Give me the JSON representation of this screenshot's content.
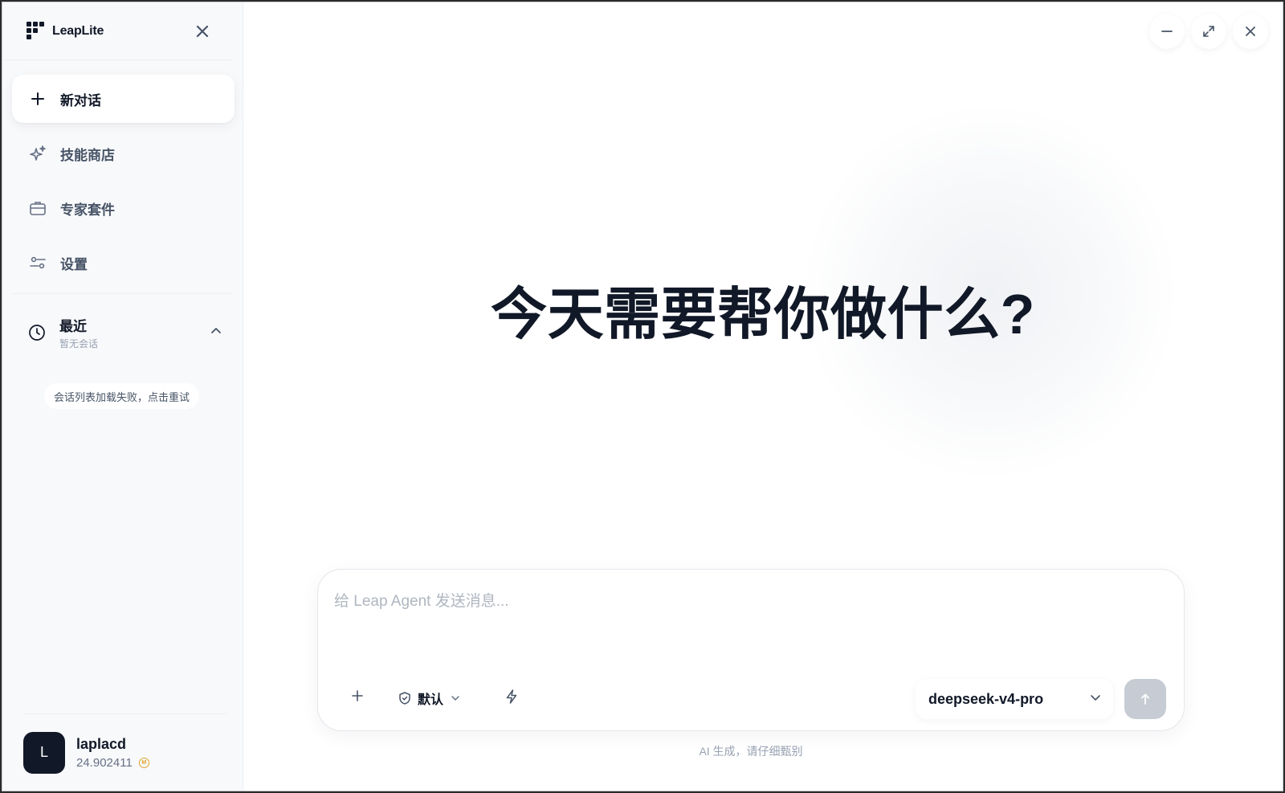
{
  "app": {
    "name": "LeapLite"
  },
  "sidebar": {
    "new_chat": "新对话",
    "items": [
      {
        "label": "技能商店",
        "icon": "sparkle-icon"
      },
      {
        "label": "专家套件",
        "icon": "briefcase-icon"
      },
      {
        "label": "设置",
        "icon": "settings-sliders-icon"
      }
    ],
    "recent": {
      "title": "最近",
      "subtitle": "暂无会话",
      "retry": "会话列表加载失败，点击重试"
    },
    "user": {
      "initial": "L",
      "name": "laplacd",
      "credit": "24.902411",
      "coin_symbol": "M"
    }
  },
  "main": {
    "headline": "今天需要帮你做什么?",
    "composer": {
      "placeholder": "给 Leap Agent 发送消息...",
      "mode": "默认",
      "model": "deepseek-v4-pro"
    },
    "footnote": "AI 生成，请仔细甄别"
  },
  "colors": {
    "text": "#111827",
    "muted": "#98a2b3",
    "send_disabled": "#c7ccd4",
    "coin": "#e0a32a"
  }
}
